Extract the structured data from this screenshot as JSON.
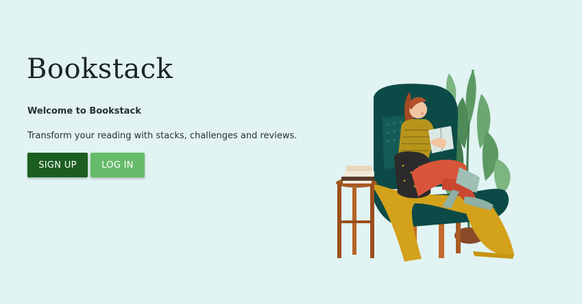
{
  "app": {
    "title": "Bookstack"
  },
  "hero": {
    "welcome": "Welcome to Bookstack",
    "tagline": "Transform your reading with stacks, challenges and reviews.",
    "signup_label": "SIGN UP",
    "login_label": "LOG IN"
  },
  "illustration": {
    "subject": "woman-reading-in-armchair-illustration"
  },
  "colors": {
    "background": "#e1f3f2",
    "signup_button": "#1b5e20",
    "login_button": "#66bb6a",
    "chair": "#0c4a47",
    "blanket": "#d3a11a",
    "pants": "#d9553a"
  }
}
